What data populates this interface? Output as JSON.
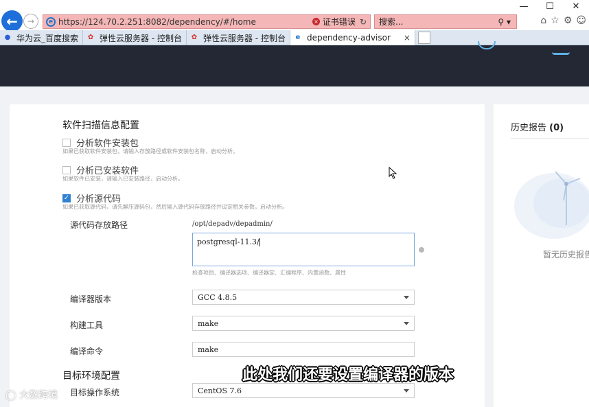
{
  "browser": {
    "url": "https://124.70.2.251:8082/dependency/#/home",
    "cert_error": "证书错误",
    "search_placeholder": "搜索...",
    "tabs": [
      {
        "label": "华为云_百度搜索",
        "icon": "baidu-paw-icon"
      },
      {
        "label": "弹性云服务器 - 控制台",
        "icon": "huawei-logo-icon"
      },
      {
        "label": "弹性云服务器 - 控制台",
        "icon": "huawei-logo-icon"
      },
      {
        "label": "dependency-advisor",
        "icon": "ie-logo-icon",
        "active": true
      }
    ]
  },
  "scan_config": {
    "title": "软件扫描信息配置",
    "options": [
      {
        "label": "分析软件安装包",
        "checked": false,
        "hint": "如果已获取软件安装包，请输入存放路径或软件安装包名称，启动分析。"
      },
      {
        "label": "分析已安装软件",
        "checked": false,
        "hint": "如果软件已安装，请输入已安装路径，启动分析。"
      },
      {
        "label": "分析源代码",
        "checked": true,
        "hint": "如果已获取源代码，请先解压源码包，然后输入源代码存放路径并设定相关参数，启动分析。"
      }
    ],
    "source_path_label": "源代码存放路径",
    "source_path_prefix": "/opt/depadv/depadmin/",
    "source_path_value": "postgresql-11.3/",
    "source_path_hint": "检查项目、编译器选项、编译器定、汇编程序、内置函数、属性",
    "compiler_label": "编译器版本",
    "compiler_value": "GCC 4.8.5",
    "build_tool_label": "构建工具",
    "build_tool_value": "make",
    "build_cmd_label": "编译命令",
    "build_cmd_value": "make"
  },
  "target_env": {
    "title": "目标环境配置",
    "os_label": "目标操作系统",
    "os_value": "CentOS 7.6"
  },
  "history": {
    "title": "历史报告",
    "count": "(0)",
    "empty_text": "暂无历史报告"
  },
  "overlay": {
    "subtitle": "此处我们还要设置编译器的版本",
    "watermark": "大数跨境"
  },
  "colors": {
    "header_bg": "#232834",
    "accent": "#2f80d1",
    "address_error": "#f4b6b6"
  }
}
